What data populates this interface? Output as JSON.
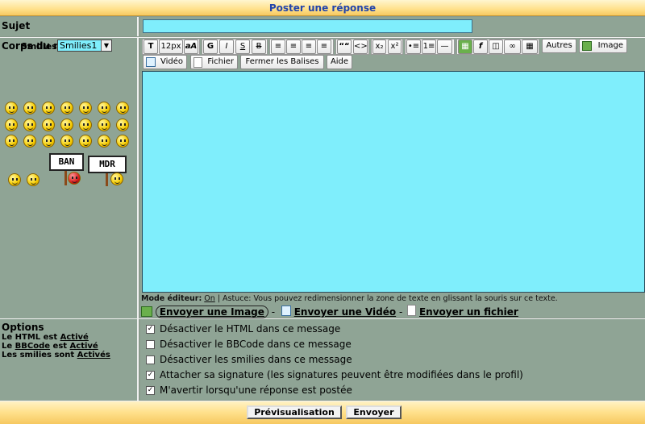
{
  "header": {
    "title": "Poster une réponse"
  },
  "subject": {
    "label": "Sujet",
    "value": ""
  },
  "body": {
    "label": "Corps du message"
  },
  "smilies": {
    "label": "Smilies:",
    "selected": "Smilies1"
  },
  "signs": {
    "ban": "BAN",
    "mdr": "MDR"
  },
  "toolbar": {
    "font_size": "12px",
    "bold": "G",
    "italic": "I",
    "underline": "S",
    "strike": "B",
    "quote": "““",
    "code": "<>",
    "autres": "Autres",
    "image": "Image",
    "video": "Vidéo",
    "fichier": "Fichier",
    "fermer": "Fermer les Balises",
    "aide": "Aide"
  },
  "hint": {
    "mode_label": "Mode éditeur:",
    "mode_value": "On",
    "text": "| Astuce: Vous pouvez redimensionner la zone de texte en glissant la souris sur ce texte."
  },
  "uploads": {
    "image": "Envoyer une Image",
    "video": "Envoyer une Vidéo",
    "file": "Envoyer un fichier",
    "sep": "-"
  },
  "options": {
    "title": "Options",
    "html_prefix": "Le HTML est",
    "html_state": "Activé",
    "bbcode_prefix1": "Le",
    "bbcode_link": "BBCode",
    "bbcode_prefix2": "est",
    "bbcode_state": "Activé",
    "smilies_prefix": "Les smilies sont",
    "smilies_state": "Activés",
    "items": [
      {
        "label": "Désactiver le HTML dans ce message",
        "checked": true,
        "mark": "✓"
      },
      {
        "label": "Désactiver le BBCode dans ce message",
        "checked": false,
        "mark": ""
      },
      {
        "label": "Désactiver les smilies dans ce message",
        "checked": false,
        "mark": ""
      },
      {
        "label": "Attacher sa signature (les signatures peuvent être modifiées dans le profil)",
        "checked": true,
        "mark": "✓"
      },
      {
        "label": "M'avertir lorsqu'une réponse est postée",
        "checked": true,
        "mark": "✓"
      }
    ]
  },
  "footer": {
    "preview": "Prévisualisation",
    "send": "Envoyer"
  },
  "colors": {
    "accent_title": "#2244aa",
    "textarea_bg": "#7feefc",
    "panel_bg": "#8fa495"
  }
}
